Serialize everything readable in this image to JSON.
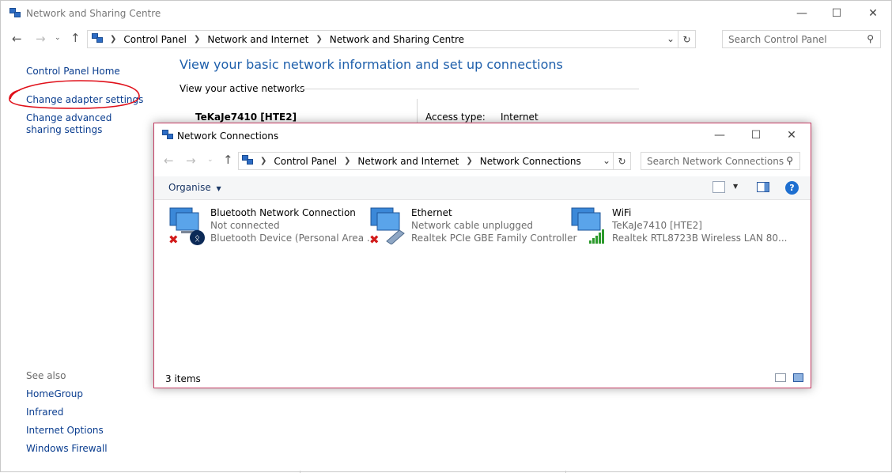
{
  "outer": {
    "title": "Network and Sharing Centre",
    "breadcrumb": [
      "Control Panel",
      "Network and Internet",
      "Network and Sharing Centre"
    ],
    "search_placeholder": "Search Control Panel",
    "sidebar": {
      "home": "Control Panel Home",
      "change_adapter": "Change adapter settings",
      "change_advanced": "Change advanced sharing settings",
      "see_also": "See also",
      "see_also_items": [
        "HomeGroup",
        "Infrared",
        "Internet Options",
        "Windows Firewall"
      ]
    },
    "main": {
      "heading": "View your basic network information and set up connections",
      "active_networks": "View your active networks",
      "network_name": "TeKaJe7410 [HTE2]",
      "access_type_label": "Access type:",
      "access_type_value": "Internet"
    }
  },
  "inner": {
    "title": "Network Connections",
    "breadcrumb": [
      "Control Panel",
      "Network and Internet",
      "Network Connections"
    ],
    "search_placeholder": "Search Network Connections",
    "organise": "Organise",
    "status": "3 items",
    "items": [
      {
        "name": "Bluetooth Network Connection",
        "status": "Not connected",
        "device": "Bluetooth Device (Personal Area ..."
      },
      {
        "name": "Ethernet",
        "status": "Network cable unplugged",
        "device": "Realtek PCIe GBE Family Controller"
      },
      {
        "name": "WiFi",
        "status": "TeKaJe7410 [HTE2]",
        "device": "Realtek RTL8723B Wireless LAN 80..."
      }
    ]
  },
  "colors": {
    "link": "#0a3d8f",
    "heading": "#1e5fab",
    "annotation": "#e0101a",
    "inner_border": "#c43b63"
  }
}
